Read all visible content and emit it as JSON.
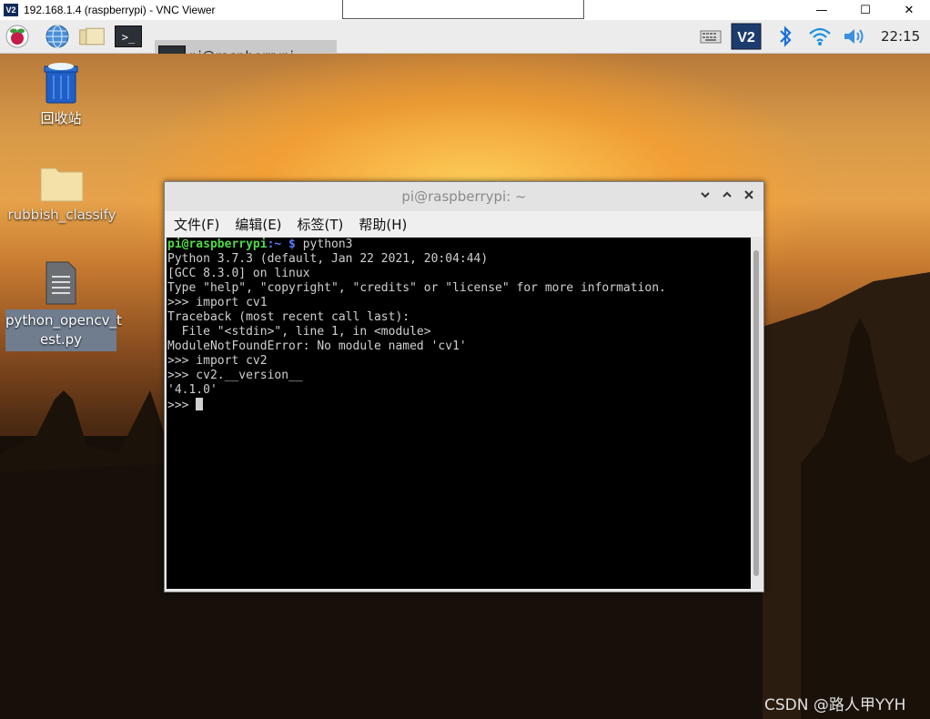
{
  "vnc": {
    "title": "192.168.1.4 (raspberrypi) - VNC Viewer",
    "logo": "V2",
    "controls": {
      "minimize": "—",
      "maximize": "☐",
      "close": "✕"
    }
  },
  "taskbar": {
    "icons": [
      "raspberry-pi-menu-icon",
      "web-browser-icon",
      "file-manager-icon",
      "terminal-icon"
    ],
    "terminal_glyph": ">_",
    "task_label": "pi@raspberrypi: ~",
    "tray_icons": [
      "keyboard-icon",
      "vnc-server-icon",
      "bluetooth-icon",
      "wifi-icon",
      "volume-icon"
    ],
    "time": "22:15"
  },
  "desktop": {
    "icons": [
      {
        "label": "回收站",
        "icon": "trash-icon"
      },
      {
        "label": "rubbish_classify",
        "icon": "folder-icon"
      },
      {
        "label_line1": "python_opencv_t",
        "label_line2": "est.py",
        "icon": "text-file-icon"
      }
    ],
    "watermark": "CSDN @路人甲YYH"
  },
  "terminal": {
    "title": "pi@raspberrypi: ~",
    "menu": [
      "文件(F)",
      "编辑(E)",
      "标签(T)",
      "帮助(H)"
    ],
    "prompt_user": "pi@raspberrypi",
    "prompt_path": ":~ $",
    "first_command": " python3",
    "output_lines": [
      "Python 3.7.3 (default, Jan 22 2021, 20:04:44)",
      "[GCC 8.3.0] on linux",
      "Type \"help\", \"copyright\", \"credits\" or \"license\" for more information.",
      ">>> import cv1",
      "Traceback (most recent call last):",
      "  File \"<stdin>\", line 1, in <module>",
      "ModuleNotFoundError: No module named 'cv1'",
      ">>> import cv2",
      ">>> cv2.__version__",
      "'4.1.0'"
    ],
    "final_prompt": ">>> "
  },
  "colors": {
    "prompt_user": "#52d94a",
    "prompt_path": "#5a7bff",
    "terminal_bg": "#000000",
    "terminal_fg": "#d0d0d0"
  }
}
